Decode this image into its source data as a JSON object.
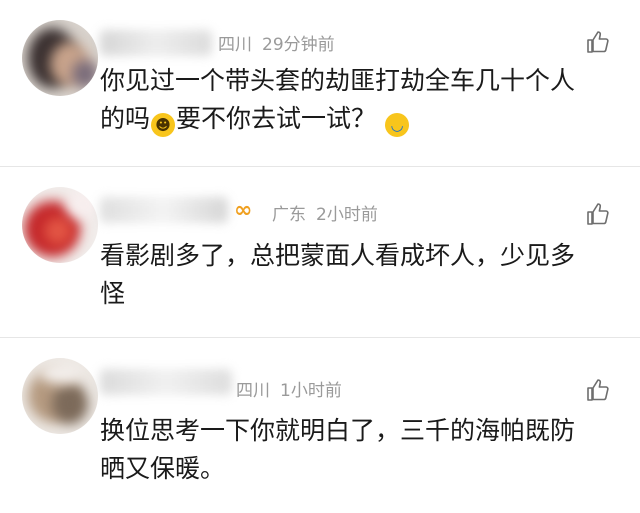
{
  "comments": [
    {
      "location": "四川",
      "time": "29分钟前",
      "text_lines": [
        "你见过一个带头套的劫匪打劫全车几十个人",
        "的吗",
        "要不你去试一试？"
      ],
      "emojis": [
        "grinning-face-emoji",
        "crying-laughing-face-emoji"
      ]
    },
    {
      "badge": "∞",
      "location": "广东",
      "time": "2小时前",
      "text_lines": [
        "看影剧多了，总把蒙面人看成坏人，少见多",
        "怪"
      ]
    },
    {
      "location": "四川",
      "time": "1小时前",
      "text_lines": [
        "换位思考一下你就明白了，三千的海帕既防",
        "晒又保暖。"
      ]
    }
  ],
  "colors": {
    "meta": "#9a9a9a",
    "text": "#1a1a1a",
    "vip_badge": "#f0a020",
    "divider": "#e6e6e6"
  },
  "icons": [
    "thumbs-up-icon"
  ]
}
